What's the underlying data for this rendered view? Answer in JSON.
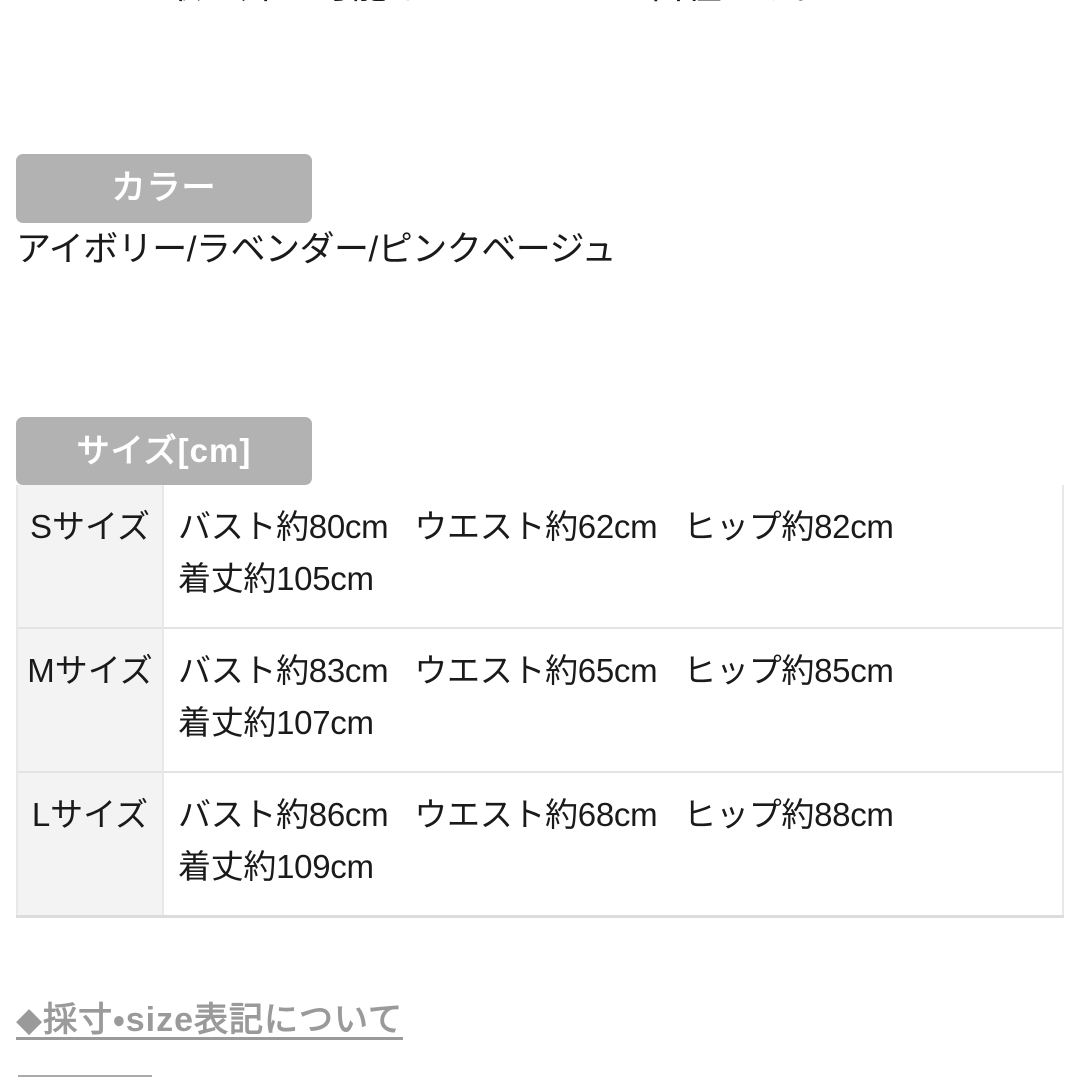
{
  "page": {
    "truncated_top_line": "ベルトは取り外し可能なのでアレンジ自在です。"
  },
  "color_section": {
    "badge_label": "カラー",
    "values_text": "アイボリー/ラベンダー/ピンクベージュ",
    "options": [
      "アイボリー",
      "ラベンダー",
      "ピンクベージュ"
    ],
    "badge_bg": "#b2b2b2",
    "badge_text_color": "#ffffff"
  },
  "size_section": {
    "badge_label": "サイズ[cm]",
    "badge_bg": "#b2b2b2",
    "badge_text_color": "#ffffff",
    "table": {
      "label_cell_bg": "#f3f3f3",
      "value_cell_bg": "#ffffff",
      "border_color": "#e3e3e3",
      "rows": [
        {
          "label": "Sサイズ",
          "bust": "バスト約80cm",
          "waist": "ウエスト約62cm",
          "hip": "ヒップ約82cm",
          "length": "着丈約105cm"
        },
        {
          "label": "Mサイズ",
          "bust": "バスト約83cm",
          "waist": "ウエスト約65cm",
          "hip": "ヒップ約85cm",
          "length": "着丈約107cm"
        },
        {
          "label": "Lサイズ",
          "bust": "バスト約86cm",
          "waist": "ウエスト約68cm",
          "hip": "ヒップ約88cm",
          "length": "着丈約109cm"
        }
      ]
    }
  },
  "footer": {
    "link_label": "◆採寸・size表記について",
    "link_color": "#9a9a9a"
  }
}
